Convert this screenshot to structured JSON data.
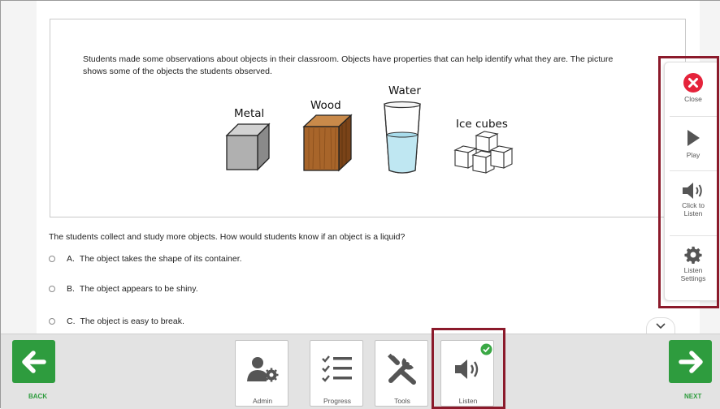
{
  "stimulus": {
    "text": "Students made some observations about objects in their classroom. Objects have properties that can help identify what they are. The picture shows some of the objects the students observed.",
    "objects": [
      "Metal",
      "Wood",
      "Water",
      "Ice cubes"
    ]
  },
  "question": {
    "text": "The students collect and study more objects. How would students know if an object is a liquid?",
    "options": [
      {
        "letter": "A.",
        "text": "The object takes the shape of its container."
      },
      {
        "letter": "B.",
        "text": "The object appears to be shiny."
      },
      {
        "letter": "C.",
        "text": "The object is easy to break."
      }
    ]
  },
  "listen_panel": {
    "close": "Close",
    "play": "Play",
    "click_to_listen": "Click to Listen",
    "settings": "Listen Settings"
  },
  "toolbar": {
    "back": "BACK",
    "next": "NEXT",
    "admin": "Admin",
    "progress": "Progress",
    "tools": "Tools",
    "listen": "Listen"
  },
  "colors": {
    "accent_green": "#2e9c3e",
    "close_red": "#e5233b",
    "highlight": "#8b1a2b"
  }
}
